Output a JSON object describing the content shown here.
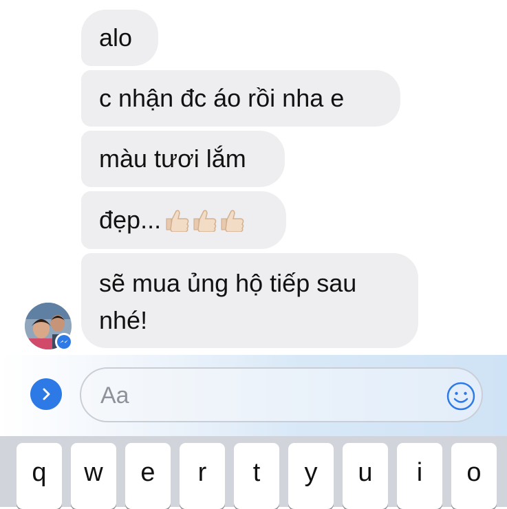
{
  "messages": [
    {
      "text": "alo",
      "emoji": ""
    },
    {
      "text": "c nhận đc áo rồi nha e",
      "emoji": ""
    },
    {
      "text": "màu tươi lắm",
      "emoji": ""
    },
    {
      "text": "đẹp...",
      "emoji": "👍🏻👍🏻👍🏻"
    },
    {
      "line1": "sẽ mua ủng hộ tiếp sau",
      "line2": "nhé!"
    }
  ],
  "composer": {
    "placeholder": "Aa",
    "expand_icon": "chevron-right-icon",
    "emoji_icon": "smiley-face-icon"
  },
  "keyboard": {
    "row1": [
      "q",
      "w",
      "e",
      "r",
      "t",
      "y",
      "u",
      "i",
      "o"
    ]
  },
  "colors": {
    "bubble": "#eeeef0",
    "accent": "#2d7ae6",
    "keyboard_bg": "#d1d5db"
  }
}
